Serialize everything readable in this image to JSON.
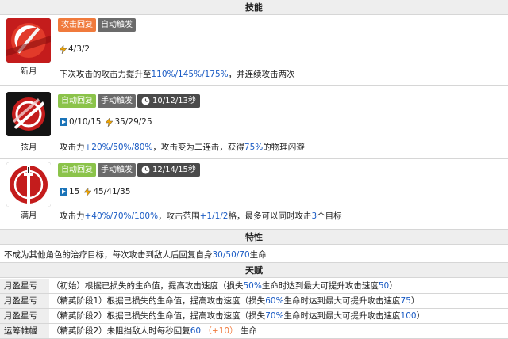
{
  "sections": {
    "skills": "技能",
    "traits": "特性",
    "talents": "天赋"
  },
  "skills": [
    {
      "name": "新月",
      "icon": "crescent-moon-blade-icon",
      "tags": [
        "攻击回复",
        "自动触发"
      ],
      "duration": "",
      "sp": {
        "init": "",
        "cost": "4/3/2"
      },
      "desc": [
        "下次攻击的攻击力提升至",
        "110%/145%/175%",
        "，并连续攻击两次"
      ]
    },
    {
      "name": "弦月",
      "icon": "half-moon-slash-icon",
      "tags": [
        "自动回复",
        "手动触发"
      ],
      "duration": "10/12/13秒",
      "sp": {
        "init": "0/10/15",
        "cost": "35/29/25"
      },
      "desc": [
        "攻击力",
        "+20%/50%/80%",
        "，攻击变为二连击，获得",
        "75%",
        "的物理闪避"
      ]
    },
    {
      "name": "满月",
      "icon": "full-moon-sword-icon",
      "tags": [
        "自动回复",
        "手动触发"
      ],
      "duration": "12/14/15秒",
      "sp": {
        "init": "15",
        "cost": "45/41/35"
      },
      "desc": [
        "攻击力",
        "+40%/70%/100%",
        "，攻击范围",
        "+1/1/2",
        "格，最多可以同时攻击",
        "3",
        "个目标"
      ]
    }
  ],
  "trait": [
    "不成为其他角色的治疗目标，每次攻击到敌人后回复自身",
    "30/50/70",
    "生命"
  ],
  "talents": [
    {
      "name": "月盈星亏",
      "desc": [
        "（初始）根据已损失的生命值，提高攻击速度（损失",
        "50%",
        "生命时达到最大可提升攻击速度",
        "50",
        "）"
      ]
    },
    {
      "name": "月盈星亏",
      "desc": [
        "（精英阶段1）根据已损失的生命值，提高攻击速度（损失",
        "60%",
        "生命时达到最大可提升攻击速度",
        "75",
        "）"
      ]
    },
    {
      "name": "月盈星亏",
      "desc": [
        "（精英阶段2）根据已损失的生命值，提高攻击速度（损失",
        "70%",
        "生命时达到最大可提升攻击速度",
        "100",
        "）"
      ]
    },
    {
      "name": "运筹帷幄",
      "desc": [
        "（精英阶段2）未阻挡敌人时每秒回复",
        "60",
        "（+10）",
        "生命"
      ]
    }
  ],
  "colors": {
    "tag_orange": "#f07a3c",
    "tag_green": "#8bc34a",
    "tag_gray": "#6b6b6b",
    "highlight_blue": "#1a5bc4",
    "header_bg": "#eeeeee"
  }
}
